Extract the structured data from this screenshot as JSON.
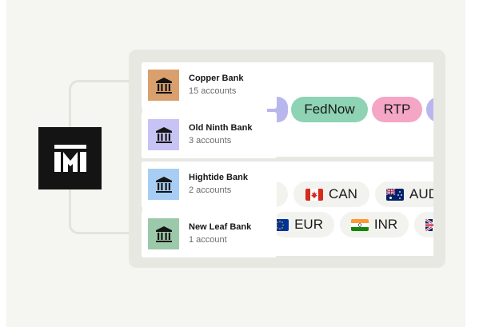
{
  "accounts": [
    {
      "name": "Copper Bank",
      "count": "15 accounts",
      "tile_color": "#d9a06d"
    },
    {
      "name": "Old Ninth Bank",
      "count": "3 accounts",
      "tile_color": "#c7c3f5"
    },
    {
      "name": "Hightide Bank",
      "count": "2 accounts",
      "tile_color": "#a8cdf4"
    },
    {
      "name": "New Leaf Bank",
      "count": "1 account",
      "tile_color": "#9cc9a9"
    }
  ],
  "payment_rails": {
    "items": [
      {
        "label": "FedNow",
        "color": "#8dd3b4"
      },
      {
        "label": "RTP",
        "color": "#f4a6c4"
      }
    ],
    "partial_color": "#b9b6ee"
  },
  "currencies": {
    "row1": [
      {
        "code": "CAN",
        "flag": "canada-flag-icon"
      },
      {
        "code": "AUD",
        "flag": "australia-flag-icon"
      }
    ],
    "row2": [
      {
        "code": "EUR",
        "flag": "eu-flag-icon"
      },
      {
        "code": "INR",
        "flag": "india-flag-icon"
      },
      {
        "code": "",
        "flag": "uk-flag-icon"
      }
    ]
  },
  "colors": {
    "background": "#f5f5f1",
    "panel": "#e8e8e3",
    "logo": "#141414"
  }
}
